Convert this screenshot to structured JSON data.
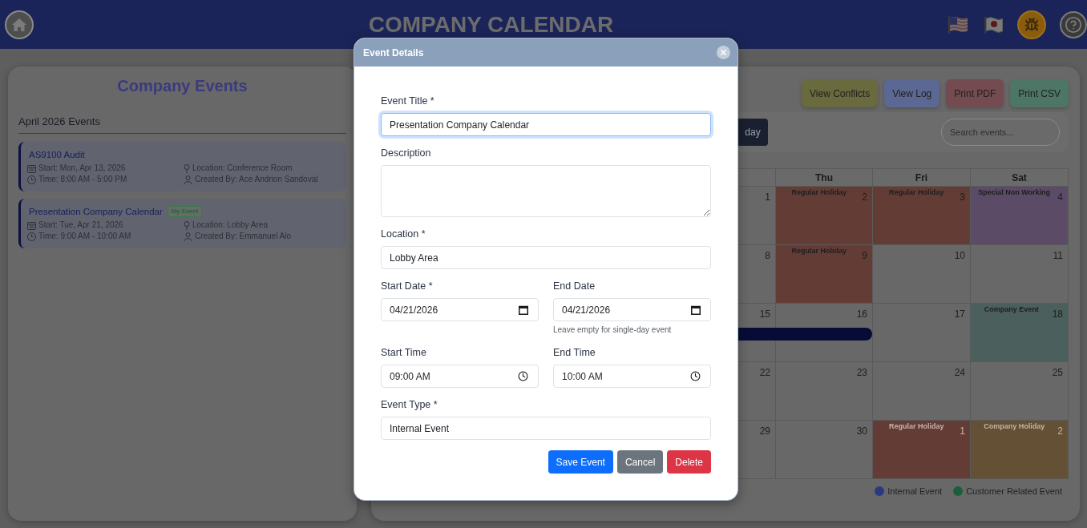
{
  "header": {
    "title": "COMPANY CALENDAR"
  },
  "sidebar": {
    "title": "Company Events",
    "section_title": "April 2026 Events",
    "events": [
      {
        "title": "AS9100 Audit",
        "start": "Start: Mon, Apr 13, 2026",
        "time": "Time: 8:00 AM - 5:00 PM",
        "location": "Location: Conference Room",
        "created_by": "Created By: Ace Andrion Sandoval"
      },
      {
        "title": "Presentation Company Calendar",
        "badge": "My Event",
        "start": "Start: Tue, Apr 21, 2026",
        "time": "Time: 9:00 AM - 10:00 AM",
        "location": "Location: Lobby Area",
        "created_by": "Created By: Emmanuel Alo"
      }
    ]
  },
  "toolbar": {
    "actions": [
      {
        "label": "View Conflicts",
        "color": "#696a3e"
      },
      {
        "label": "View Log",
        "color": "#5a6893"
      },
      {
        "label": "Print PDF",
        "color": "#744b50"
      },
      {
        "label": "Print CSV",
        "color": "#4d7666"
      }
    ],
    "view_buttons": [
      {
        "label": "day",
        "selected": true
      }
    ],
    "search": {
      "placeholder": "Search events..."
    }
  },
  "calendar": {
    "weekday_headers": [
      "Thu",
      "Fri",
      "Sat"
    ],
    "weeks": [
      {
        "days": [
          {
            "day": "1",
            "kind": "normal",
            "outside_month": false
          },
          {
            "day": "2",
            "kind": "regular_holiday",
            "label": "Regular Holiday",
            "outside_month": false
          },
          {
            "day": "3",
            "kind": "regular_holiday",
            "label": "Regular Holiday",
            "outside_month": false
          },
          {
            "day": "4",
            "kind": "special_non_working",
            "label": "Special Non Working",
            "outside_month": false
          }
        ]
      },
      {
        "days": [
          {
            "day": "8",
            "kind": "normal",
            "outside_month": false
          },
          {
            "day": "9",
            "kind": "regular_holiday",
            "label": "Regular Holiday",
            "outside_month": false
          },
          {
            "day": "10",
            "kind": "normal",
            "outside_month": false
          },
          {
            "day": "11",
            "kind": "normal",
            "outside_month": false
          }
        ]
      },
      {
        "event_bar": {
          "kind": "internal"
        },
        "days": [
          {
            "day": "15",
            "kind": "normal",
            "outside_month": false
          },
          {
            "day": "16",
            "kind": "normal",
            "outside_month": false
          },
          {
            "day": "17",
            "kind": "normal",
            "outside_month": false
          },
          {
            "day": "18",
            "kind": "company_event",
            "label": "Company Event",
            "outside_month": false
          }
        ]
      },
      {
        "days": [
          {
            "day": "22",
            "kind": "normal",
            "outside_month": false
          },
          {
            "day": "23",
            "kind": "normal",
            "outside_month": false
          },
          {
            "day": "24",
            "kind": "normal",
            "outside_month": false
          },
          {
            "day": "25",
            "kind": "normal",
            "outside_month": false
          }
        ]
      },
      {
        "days": [
          {
            "day": "29",
            "kind": "normal",
            "outside_month": false
          },
          {
            "day": "30",
            "kind": "normal",
            "outside_month": false
          },
          {
            "day": "1",
            "kind": "regular_holiday",
            "label": "Regular Holiday",
            "outside_month": true
          },
          {
            "day": "2",
            "kind": "company_holiday",
            "label": "Company Holiday",
            "outside_month": true
          }
        ]
      }
    ],
    "legend": [
      {
        "label": "Internal Event",
        "color": "#2b3a80"
      },
      {
        "label": "Customer Related Event",
        "color": "#1b5e3a"
      }
    ]
  },
  "modal": {
    "title": "Event Details",
    "field_rows": [
      {
        "fields": [
          {
            "label": "Event Title *",
            "kind": "text",
            "value": "Presentation Company Calendar",
            "focused": true
          }
        ]
      },
      {
        "fields": [
          {
            "label": "Description",
            "kind": "textarea",
            "focused": false
          }
        ]
      },
      {
        "fields": [
          {
            "label": "Location *",
            "kind": "text",
            "value": "Lobby Area",
            "focused": false
          }
        ]
      },
      {
        "fields": [
          {
            "label": "Start Date *",
            "kind": "date",
            "value": "04/21/2026",
            "focused": false
          },
          {
            "label": "End Date",
            "kind": "date",
            "value": "04/21/2026",
            "help": "Leave empty for single-day event",
            "focused": false
          }
        ]
      },
      {
        "fields": [
          {
            "label": "Start Time",
            "kind": "time",
            "value": "09:00 AM",
            "focused": false
          },
          {
            "label": "End Time",
            "kind": "time",
            "value": "10:00 AM",
            "focused": false
          }
        ]
      },
      {
        "fields": [
          {
            "label": "Event Type *",
            "kind": "text",
            "value": "Internal Event",
            "focused": false
          }
        ]
      }
    ],
    "buttons": [
      {
        "label": "Save Event",
        "kind": "primary"
      },
      {
        "label": "Cancel",
        "kind": "secondary"
      },
      {
        "label": "Delete",
        "kind": "danger"
      }
    ]
  }
}
